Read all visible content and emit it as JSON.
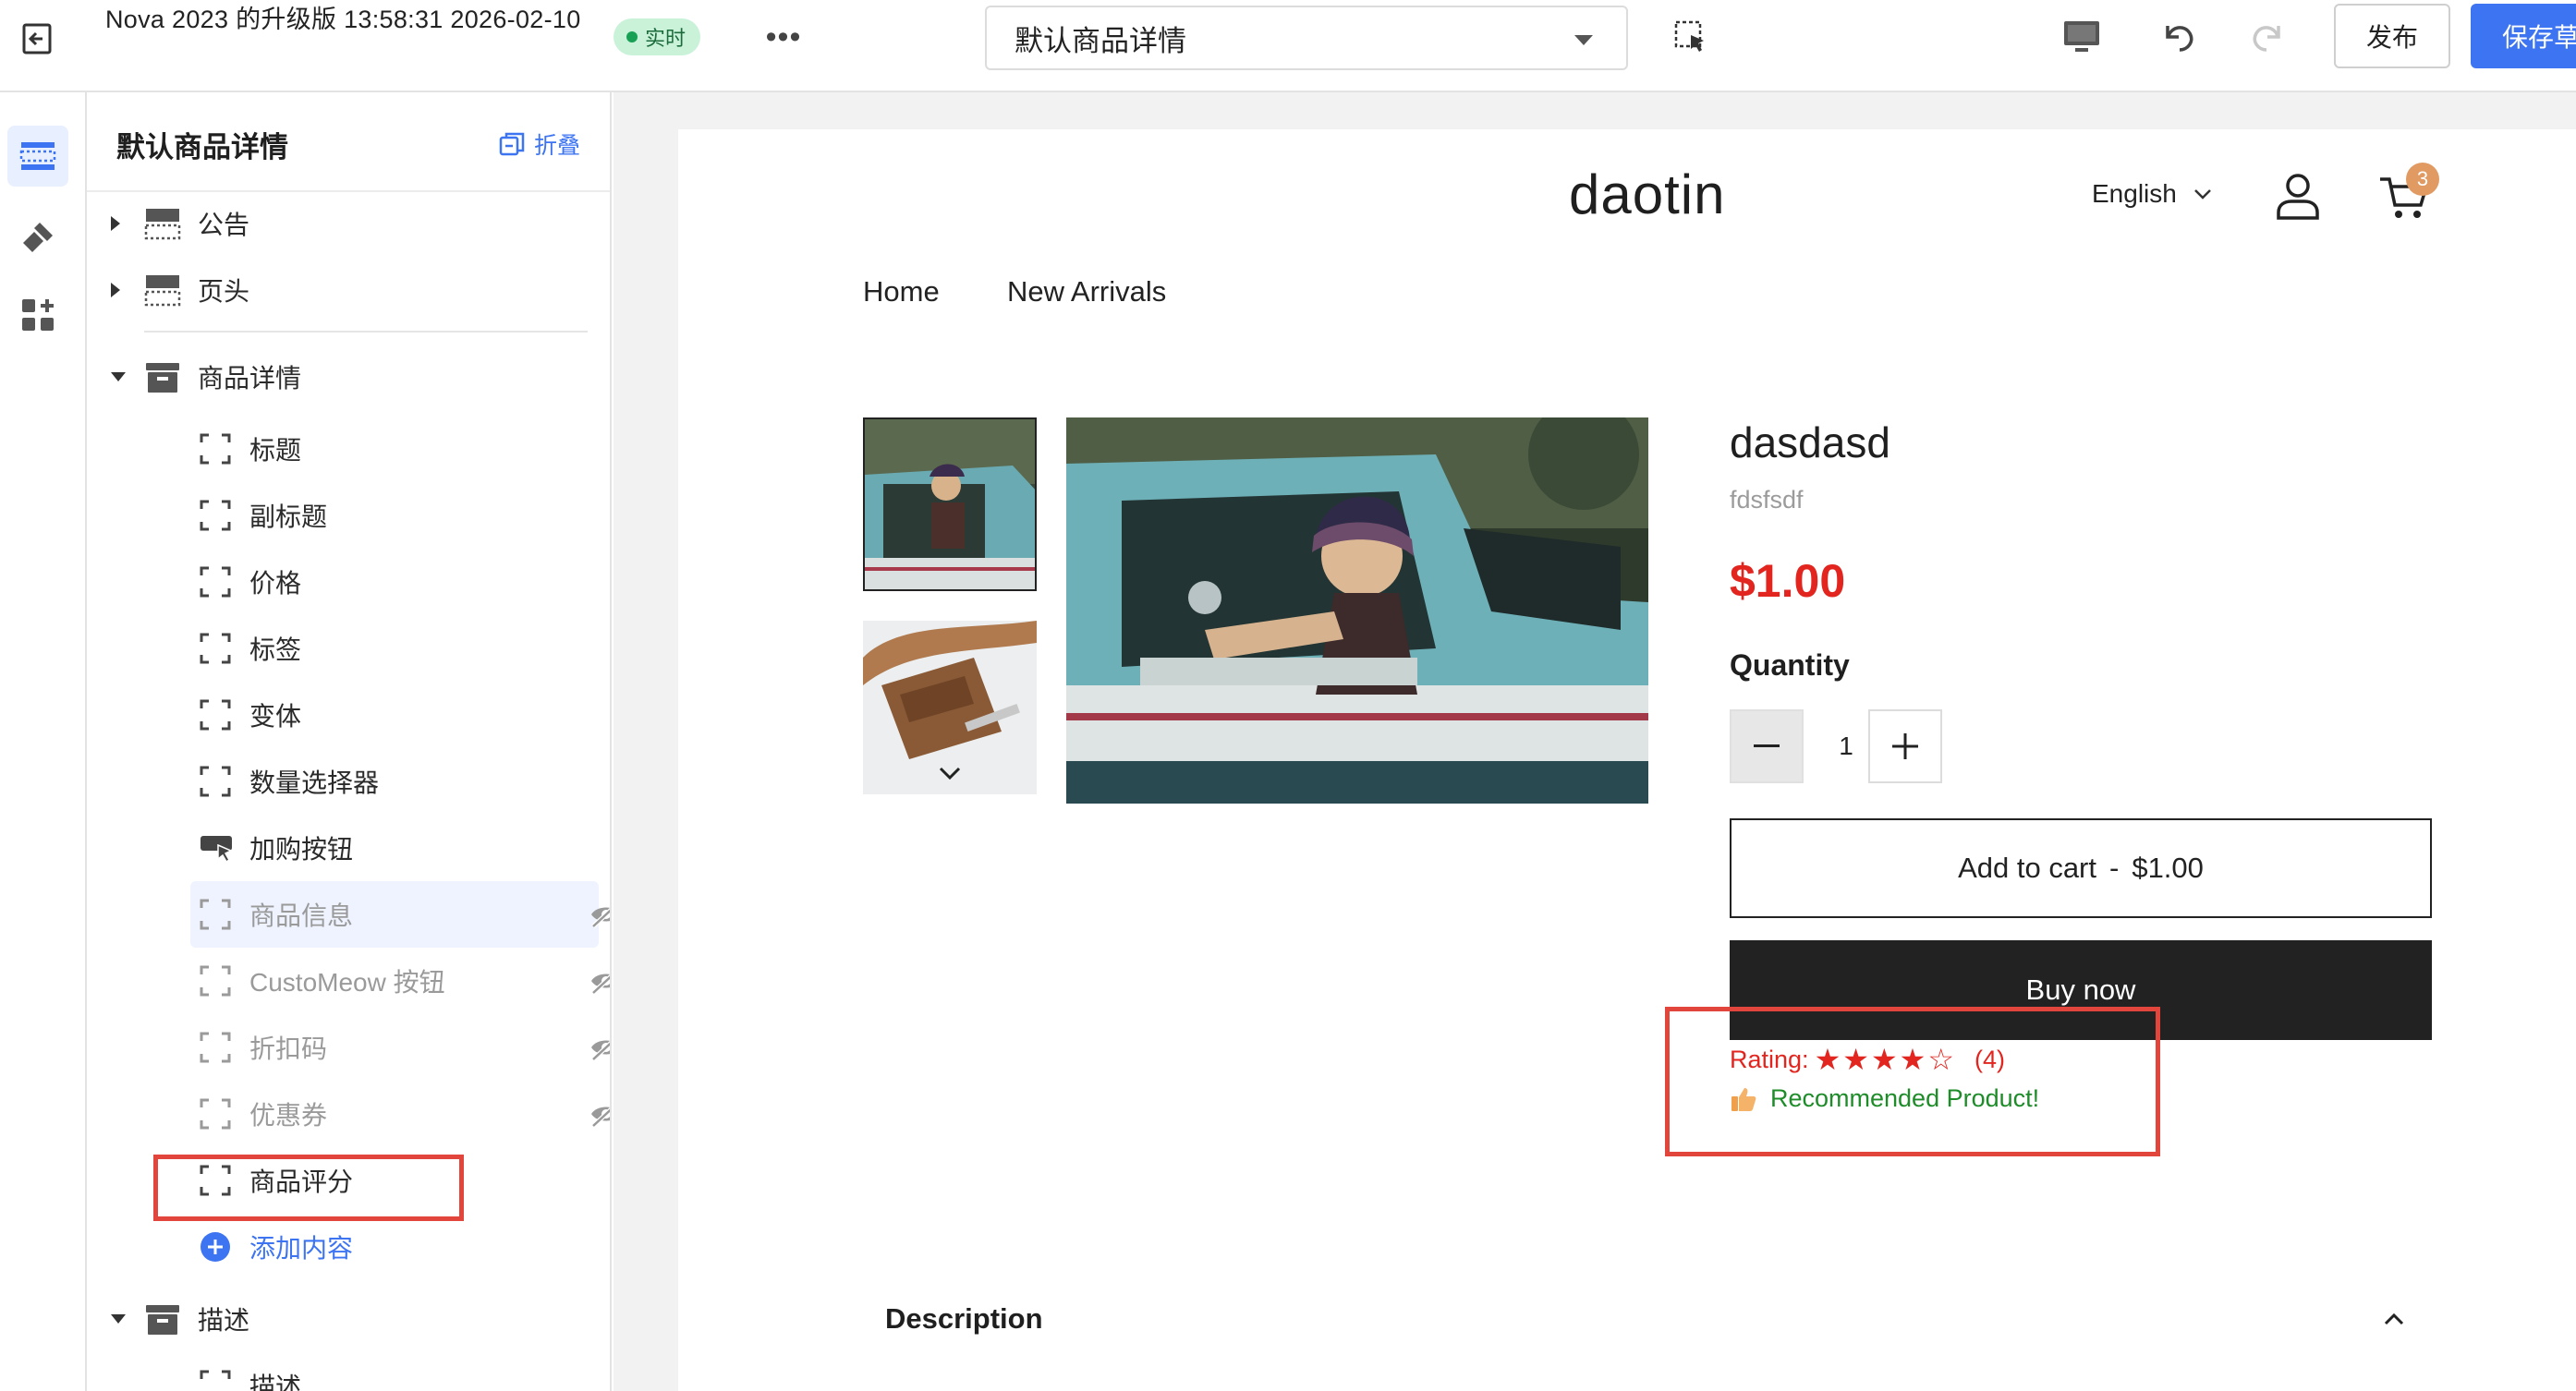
{
  "topbar": {
    "title": "Nova 2023 的升级版 13:58:31 2026-02-10",
    "live_badge": "实时",
    "more_label": "•••",
    "page_select": "默认商品详情",
    "publish_label": "发布",
    "save_label": "保存草"
  },
  "sidebar": {
    "title": "默认商品详情",
    "collapse_label": "折叠",
    "sections": {
      "announcement": "公告",
      "header": "页头",
      "product_detail": "商品详情",
      "description": "描述"
    },
    "blocks": [
      {
        "label": "标题"
      },
      {
        "label": "副标题"
      },
      {
        "label": "价格"
      },
      {
        "label": "标签"
      },
      {
        "label": "变体"
      },
      {
        "label": "数量选择器"
      },
      {
        "label": "加购按钮"
      },
      {
        "label": "商品信息"
      },
      {
        "label": "CustoMeow 按钮"
      },
      {
        "label": "折扣码"
      },
      {
        "label": "优惠券"
      },
      {
        "label": "商品评分"
      }
    ],
    "add_content": "添加内容",
    "desc_child": "描述"
  },
  "store": {
    "logo": "daotin",
    "language": "English",
    "cart_count": "3",
    "nav": [
      "Home",
      "New Arrivals"
    ]
  },
  "product": {
    "title": "dasdasd",
    "subtitle": "fdsfsdf",
    "price": "$1.00",
    "quantity_label": "Quantity",
    "quantity": "1",
    "add_to_cart": "Add to cart",
    "add_to_cart_sep": "-",
    "add_to_cart_price": "$1.00",
    "buy_now": "Buy now",
    "rating_label": "Rating:",
    "rating_value": 4,
    "rating_max": 5,
    "rating_stars": "★★★★☆",
    "rating_count": "(4)",
    "recommend": "Recommended Product!",
    "description_title": "Description"
  },
  "colors": {
    "accent": "#3d74f2",
    "price_red": "#e2261f",
    "highlight_box": "#e2453c",
    "live_green": "#18a054",
    "recommend_green": "#1f8c2a"
  }
}
